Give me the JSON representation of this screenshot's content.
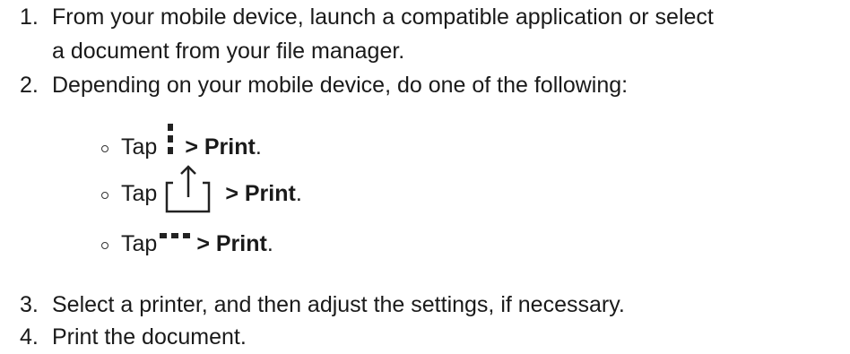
{
  "steps": [
    {
      "number": "1.",
      "line1": "From your mobile device, launch a compatible application or select",
      "line2": "a document from your file manager."
    },
    {
      "number": "2.",
      "line1": "Depending on your mobile device, do one of the following:"
    },
    {
      "number": "3.",
      "line1": "Select a printer, and then adjust the settings, if necessary."
    },
    {
      "number": "4.",
      "line1": "Print the document."
    }
  ],
  "substeps": [
    {
      "tap": "Tap",
      "icon": "vertical-ellipsis-icon",
      "action": "> Print",
      "end": "."
    },
    {
      "tap": "Tap",
      "icon": "share-icon",
      "action": "> Print",
      "end": "."
    },
    {
      "tap": "Tap",
      "icon": "horizontal-ellipsis-icon",
      "action": "> Print",
      "end": "."
    }
  ]
}
